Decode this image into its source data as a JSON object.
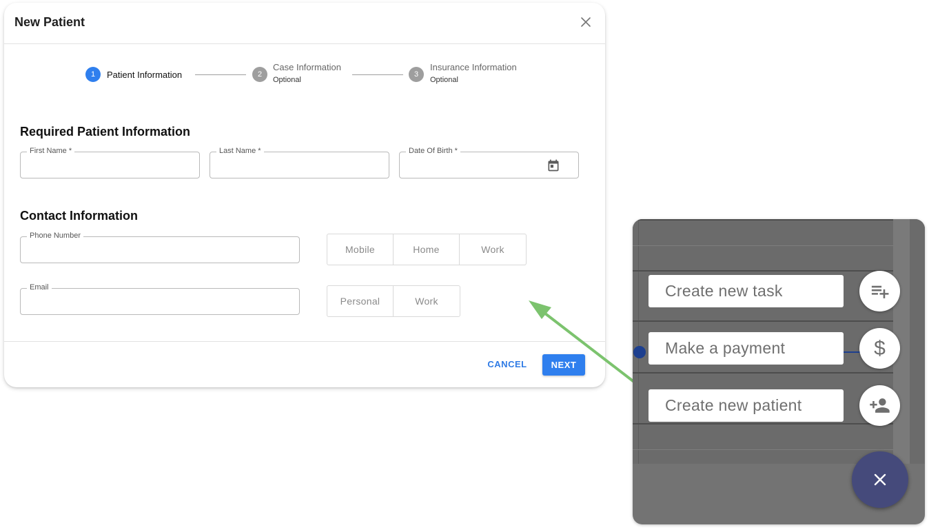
{
  "dialog": {
    "title": "New Patient",
    "steps": [
      {
        "number": "1",
        "label": "Patient Information",
        "sub": "",
        "active": true
      },
      {
        "number": "2",
        "label": "Case Information",
        "sub": "Optional",
        "active": false
      },
      {
        "number": "3",
        "label": "Insurance Information",
        "sub": "Optional",
        "active": false
      }
    ],
    "required_section": {
      "title": "Required Patient Information",
      "first_name_label": "First Name *",
      "first_name_value": "",
      "last_name_label": "Last Name *",
      "last_name_value": "",
      "dob_label": "Date Of Birth *",
      "dob_value": "",
      "dob_icon": "calendar-icon"
    },
    "contact_section": {
      "title": "Contact Information",
      "phone_label": "Phone Number",
      "phone_value": "",
      "phone_types": [
        "Mobile",
        "Home",
        "Work"
      ],
      "email_label": "Email",
      "email_value": "",
      "email_types": [
        "Personal",
        "Work"
      ]
    },
    "actions": {
      "cancel_label": "CANCEL",
      "next_label": "NEXT"
    }
  },
  "fab_menu": {
    "items": [
      {
        "label": "Create new task",
        "icon": "playlist-add-icon"
      },
      {
        "label": "Make a payment",
        "icon": "dollar-icon",
        "glyph": "$"
      },
      {
        "label": "Create new patient",
        "icon": "person-add-icon"
      }
    ],
    "main_icon": "close-icon"
  },
  "colors": {
    "accent": "#2f7fee",
    "step_active": "#2f7fee",
    "step_inactive": "#9e9e9e",
    "arrow": "#7cc36e",
    "fab_main": "#454a7b",
    "overlay": "#6b6b6b"
  }
}
